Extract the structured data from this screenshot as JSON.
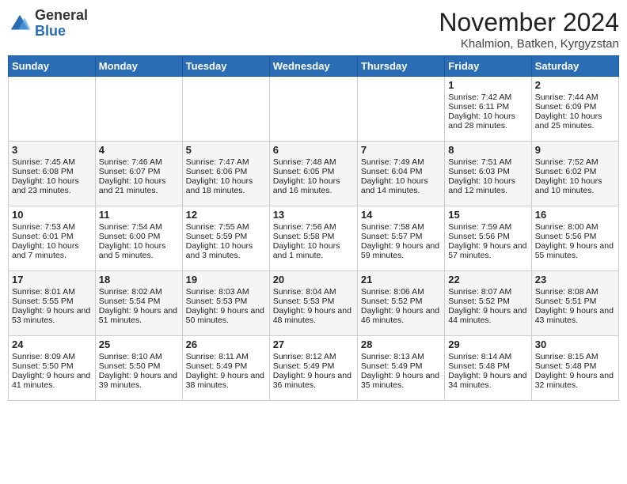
{
  "header": {
    "logo": {
      "line1": "General",
      "line2": "Blue"
    },
    "title": "November 2024",
    "location": "Khalmion, Batken, Kyrgyzstan"
  },
  "days_of_week": [
    "Sunday",
    "Monday",
    "Tuesday",
    "Wednesday",
    "Thursday",
    "Friday",
    "Saturday"
  ],
  "weeks": [
    [
      {
        "day": "",
        "info": ""
      },
      {
        "day": "",
        "info": ""
      },
      {
        "day": "",
        "info": ""
      },
      {
        "day": "",
        "info": ""
      },
      {
        "day": "",
        "info": ""
      },
      {
        "day": "1",
        "info": "Sunrise: 7:42 AM\nSunset: 6:11 PM\nDaylight: 10 hours and 28 minutes."
      },
      {
        "day": "2",
        "info": "Sunrise: 7:44 AM\nSunset: 6:09 PM\nDaylight: 10 hours and 25 minutes."
      }
    ],
    [
      {
        "day": "3",
        "info": "Sunrise: 7:45 AM\nSunset: 6:08 PM\nDaylight: 10 hours and 23 minutes."
      },
      {
        "day": "4",
        "info": "Sunrise: 7:46 AM\nSunset: 6:07 PM\nDaylight: 10 hours and 21 minutes."
      },
      {
        "day": "5",
        "info": "Sunrise: 7:47 AM\nSunset: 6:06 PM\nDaylight: 10 hours and 18 minutes."
      },
      {
        "day": "6",
        "info": "Sunrise: 7:48 AM\nSunset: 6:05 PM\nDaylight: 10 hours and 16 minutes."
      },
      {
        "day": "7",
        "info": "Sunrise: 7:49 AM\nSunset: 6:04 PM\nDaylight: 10 hours and 14 minutes."
      },
      {
        "day": "8",
        "info": "Sunrise: 7:51 AM\nSunset: 6:03 PM\nDaylight: 10 hours and 12 minutes."
      },
      {
        "day": "9",
        "info": "Sunrise: 7:52 AM\nSunset: 6:02 PM\nDaylight: 10 hours and 10 minutes."
      }
    ],
    [
      {
        "day": "10",
        "info": "Sunrise: 7:53 AM\nSunset: 6:01 PM\nDaylight: 10 hours and 7 minutes."
      },
      {
        "day": "11",
        "info": "Sunrise: 7:54 AM\nSunset: 6:00 PM\nDaylight: 10 hours and 5 minutes."
      },
      {
        "day": "12",
        "info": "Sunrise: 7:55 AM\nSunset: 5:59 PM\nDaylight: 10 hours and 3 minutes."
      },
      {
        "day": "13",
        "info": "Sunrise: 7:56 AM\nSunset: 5:58 PM\nDaylight: 10 hours and 1 minute."
      },
      {
        "day": "14",
        "info": "Sunrise: 7:58 AM\nSunset: 5:57 PM\nDaylight: 9 hours and 59 minutes."
      },
      {
        "day": "15",
        "info": "Sunrise: 7:59 AM\nSunset: 5:56 PM\nDaylight: 9 hours and 57 minutes."
      },
      {
        "day": "16",
        "info": "Sunrise: 8:00 AM\nSunset: 5:56 PM\nDaylight: 9 hours and 55 minutes."
      }
    ],
    [
      {
        "day": "17",
        "info": "Sunrise: 8:01 AM\nSunset: 5:55 PM\nDaylight: 9 hours and 53 minutes."
      },
      {
        "day": "18",
        "info": "Sunrise: 8:02 AM\nSunset: 5:54 PM\nDaylight: 9 hours and 51 minutes."
      },
      {
        "day": "19",
        "info": "Sunrise: 8:03 AM\nSunset: 5:53 PM\nDaylight: 9 hours and 50 minutes."
      },
      {
        "day": "20",
        "info": "Sunrise: 8:04 AM\nSunset: 5:53 PM\nDaylight: 9 hours and 48 minutes."
      },
      {
        "day": "21",
        "info": "Sunrise: 8:06 AM\nSunset: 5:52 PM\nDaylight: 9 hours and 46 minutes."
      },
      {
        "day": "22",
        "info": "Sunrise: 8:07 AM\nSunset: 5:52 PM\nDaylight: 9 hours and 44 minutes."
      },
      {
        "day": "23",
        "info": "Sunrise: 8:08 AM\nSunset: 5:51 PM\nDaylight: 9 hours and 43 minutes."
      }
    ],
    [
      {
        "day": "24",
        "info": "Sunrise: 8:09 AM\nSunset: 5:50 PM\nDaylight: 9 hours and 41 minutes."
      },
      {
        "day": "25",
        "info": "Sunrise: 8:10 AM\nSunset: 5:50 PM\nDaylight: 9 hours and 39 minutes."
      },
      {
        "day": "26",
        "info": "Sunrise: 8:11 AM\nSunset: 5:49 PM\nDaylight: 9 hours and 38 minutes."
      },
      {
        "day": "27",
        "info": "Sunrise: 8:12 AM\nSunset: 5:49 PM\nDaylight: 9 hours and 36 minutes."
      },
      {
        "day": "28",
        "info": "Sunrise: 8:13 AM\nSunset: 5:49 PM\nDaylight: 9 hours and 35 minutes."
      },
      {
        "day": "29",
        "info": "Sunrise: 8:14 AM\nSunset: 5:48 PM\nDaylight: 9 hours and 34 minutes."
      },
      {
        "day": "30",
        "info": "Sunrise: 8:15 AM\nSunset: 5:48 PM\nDaylight: 9 hours and 32 minutes."
      }
    ]
  ]
}
